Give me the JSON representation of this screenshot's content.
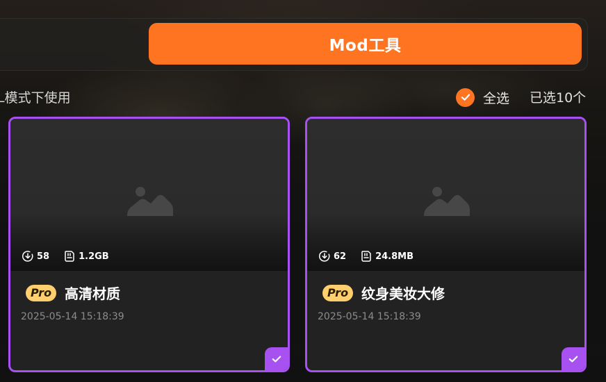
{
  "toolbar": {
    "mod_tool_label": "Mod工具"
  },
  "hint": {
    "text": "L模式下使用"
  },
  "selection": {
    "select_all_label": "全选",
    "selected_count_label": "已选10个",
    "all_selected": true
  },
  "cards": [
    {
      "downloads": "58",
      "size": "1.2GB",
      "badge": "Pro",
      "title": "高清材质",
      "date": "2025-05-14 15:18:39",
      "selected": true
    },
    {
      "downloads": "62",
      "size": "24.8MB",
      "badge": "Pro",
      "title": "纹身美妆大修",
      "date": "2025-05-14 15:18:39",
      "selected": true
    }
  ],
  "colors": {
    "accent_orange": "#ff7421",
    "selected_purple": "#a651f0",
    "pro_badge": "#ffcf6e",
    "background": "#141414"
  },
  "icons": {
    "thumbnail": "image-placeholder-icon",
    "downloads": "download-icon",
    "size": "storage-icon",
    "select_all": "check-circle-icon",
    "card_selected": "checkmark-icon"
  }
}
